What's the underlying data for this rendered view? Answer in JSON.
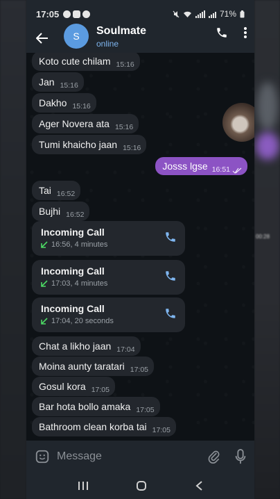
{
  "status": {
    "time": "17:05",
    "battery": "71%"
  },
  "header": {
    "avatar_letter": "S",
    "name": "Soulmate",
    "subtitle": "online"
  },
  "messages": [
    {
      "text": "Koto cute chilam",
      "time": "15:16"
    },
    {
      "text": "Jan",
      "time": "15:16"
    },
    {
      "text": "Dakho",
      "time": "15:16"
    },
    {
      "text": "Ager Novera ata",
      "time": "15:16"
    },
    {
      "text": "Tumi khaicho jaan",
      "time": "15:16"
    },
    {
      "text": "Josss lgse",
      "time": "16:51"
    },
    {
      "text": "Tai",
      "time": "16:52"
    },
    {
      "text": "Bujhi",
      "time": "16:52"
    },
    {
      "text": "Chat a likho jaan",
      "time": "17:04"
    },
    {
      "text": "Moina aunty taratari",
      "time": "17:05"
    },
    {
      "text": "Gosul kora",
      "time": "17:05"
    },
    {
      "text": "Bar hota bollo amaka",
      "time": "17:05"
    },
    {
      "text": "Bathroom clean korba tai",
      "time": "17:05"
    }
  ],
  "calls": [
    {
      "title": "Incoming Call",
      "detail": "16:56, 4 minutes"
    },
    {
      "title": "Incoming Call",
      "detail": "17:03, 4 minutes"
    },
    {
      "title": "Incoming Call",
      "detail": "17:04, 20 seconds"
    }
  ],
  "input": {
    "placeholder": "Message"
  },
  "side_label": "00:28",
  "colors": {
    "outgoing": "#8c53c4",
    "incoming": "#23272d",
    "accent": "#7fb6f0",
    "call_arrow": "#4cd964"
  }
}
